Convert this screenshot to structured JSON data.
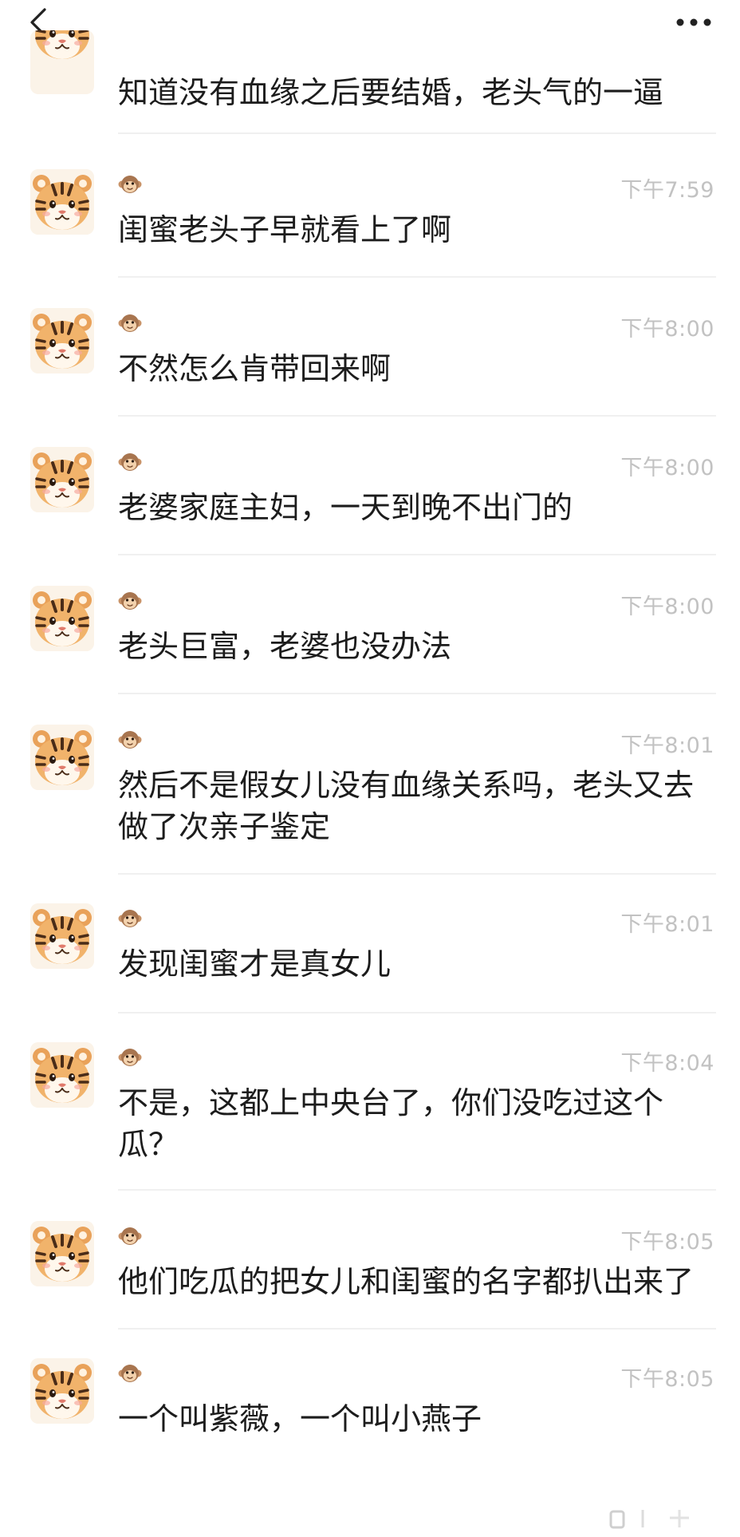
{
  "header": {
    "back_icon": "chevron-left-icon",
    "more_icon": "more-horizontal-icon"
  },
  "messages": [
    {
      "time": "",
      "text": "知道没有血缘之后要结婚，老头气的一逼"
    },
    {
      "time": "下午7:59",
      "text": "闺蜜老头子早就看上了啊"
    },
    {
      "time": "下午8:00",
      "text": "不然怎么肯带回来啊"
    },
    {
      "time": "下午8:00",
      "text": "老婆家庭主妇，一天到晚不出门的"
    },
    {
      "time": "下午8:00",
      "text": "老头巨富，老婆也没办法"
    },
    {
      "time": "下午8:01",
      "text": "然后不是假女儿没有血缘关系吗，老头又去做了次亲子鉴定"
    },
    {
      "time": "下午8:01",
      "text": "发现闺蜜才是真女儿"
    },
    {
      "time": "下午8:04",
      "text": "不是，这都上中央台了，你们没吃过这个瓜？"
    },
    {
      "time": "下午8:05",
      "text": "他们吃瓜的把女儿和闺蜜的名字都扒出来了"
    },
    {
      "time": "下午8:05",
      "text": "一个叫紫薇，一个叫小燕子"
    }
  ],
  "avatar_icon": "tiger-avatar-icon",
  "badge_icon": "monkey-face-icon",
  "colors": {
    "time": "#c2c2c2",
    "divider": "#f0f0f0",
    "text": "#1c1c1c"
  }
}
